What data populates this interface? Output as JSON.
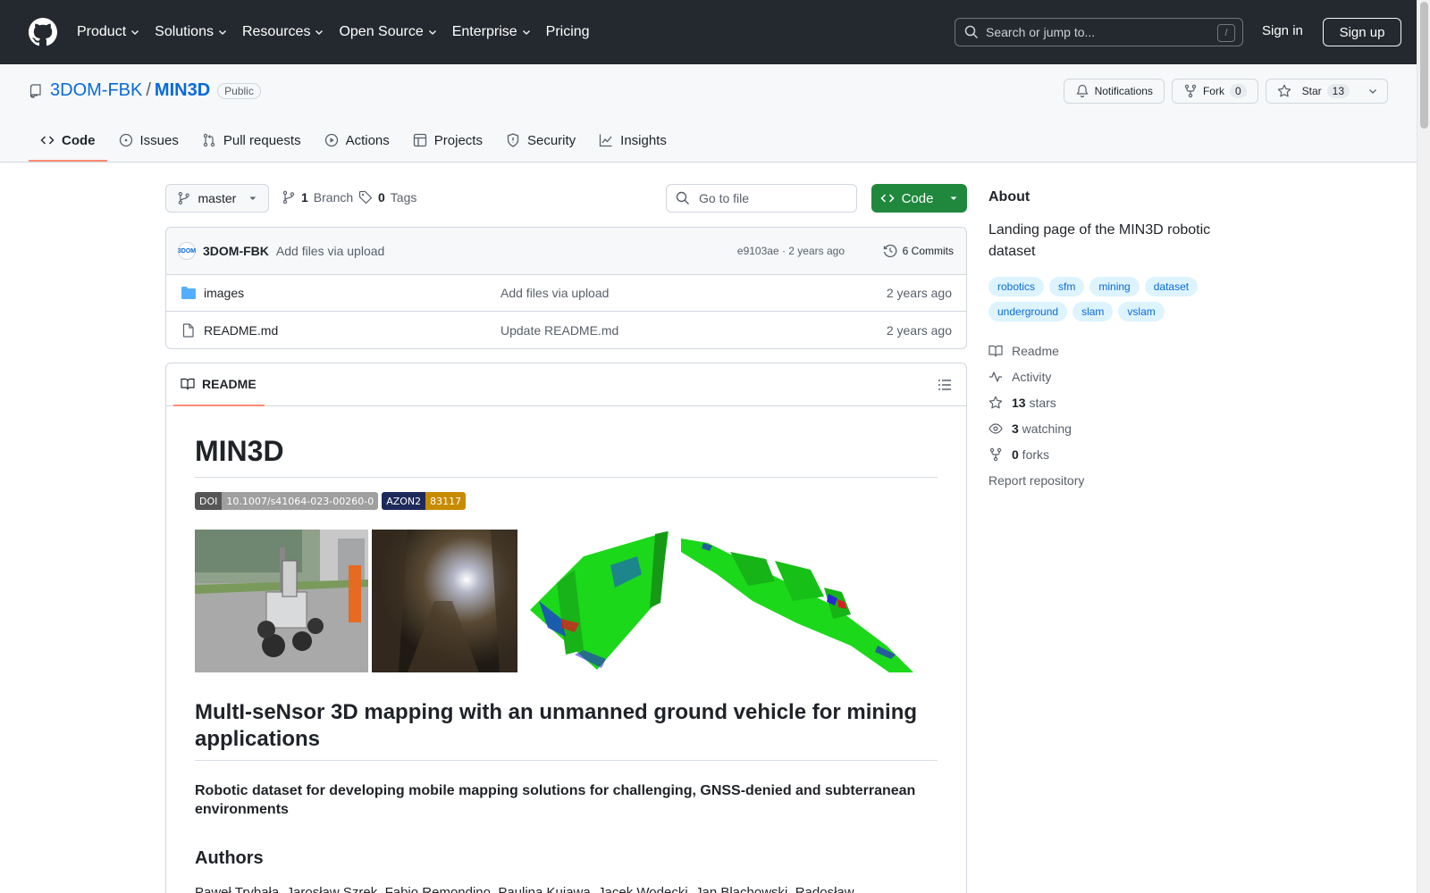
{
  "header": {
    "nav": [
      {
        "label": "Product",
        "has_chevron": true
      },
      {
        "label": "Solutions",
        "has_chevron": true
      },
      {
        "label": "Resources",
        "has_chevron": true
      },
      {
        "label": "Open Source",
        "has_chevron": true
      },
      {
        "label": "Enterprise",
        "has_chevron": true
      },
      {
        "label": "Pricing",
        "has_chevron": false
      }
    ],
    "search_placeholder": "Search or jump to...",
    "search_kbd": "/",
    "sign_in": "Sign in",
    "sign_up": "Sign up"
  },
  "repo": {
    "owner": "3DOM-FBK",
    "separator": "/",
    "name": "MIN3D",
    "visibility": "Public",
    "notifications_label": "Notifications",
    "fork_label": "Fork",
    "fork_count": "0",
    "star_label": "Star",
    "star_count": "13",
    "tabs": [
      "Code",
      "Issues",
      "Pull requests",
      "Actions",
      "Projects",
      "Security",
      "Insights"
    ]
  },
  "toolbar": {
    "branch": "master",
    "branch_count": "1",
    "branch_label": "Branch",
    "tag_count": "0",
    "tag_label": "Tags",
    "goto_placeholder": "Go to file",
    "code_button": "Code"
  },
  "commit": {
    "author": "3DOM-FBK",
    "avatar_text": "3DOM",
    "message": "Add files via upload",
    "meta": "e9103ae · 2 years ago",
    "commits_label": "6 Commits"
  },
  "files": [
    {
      "type": "folder",
      "name": "images",
      "message": "Add files via upload",
      "date": "2 years ago"
    },
    {
      "type": "file",
      "name": "README.md",
      "message": "Update README.md",
      "date": "2 years ago"
    }
  ],
  "readme": {
    "tab_label": "README",
    "h1": "MIN3D",
    "badges": [
      {
        "left": "DOI",
        "right": "10.1007/s41064-023-00260-0",
        "color": "#9f9f9f"
      },
      {
        "left": "AZON2",
        "right": "83117",
        "color": "#c78b00"
      }
    ],
    "h2": "MultI-seNsor 3D mapping with an unmanned ground vehicle for mining applications",
    "h4": "Robotic dataset for developing mobile mapping solutions for challenging, GNSS-denied and subterranean environments",
    "authors_heading": "Authors",
    "authors_line": "Paweł Trybała, Jarosław Szrek, Fabio Remondino, Paulina Kujawa, Jacek Wodecki, Jan Blachowski, Radosław"
  },
  "about": {
    "heading": "About",
    "description": "Landing page of the MIN3D robotic dataset",
    "topics": [
      "robotics",
      "sfm",
      "mining",
      "dataset",
      "underground",
      "slam",
      "vslam"
    ],
    "links": [
      {
        "icon": "book-icon",
        "bold": "",
        "text": "Readme"
      },
      {
        "icon": "pulse-icon",
        "bold": "",
        "text": "Activity"
      },
      {
        "icon": "star-icon",
        "bold": "13",
        "text": " stars"
      },
      {
        "icon": "eye-icon",
        "bold": "3",
        "text": " watching"
      },
      {
        "icon": "fork-icon",
        "bold": "0",
        "text": " forks"
      },
      {
        "icon": "",
        "bold": "",
        "text": "Report repository"
      }
    ]
  },
  "colors": {
    "header_bg": "#24292f",
    "link": "#0969da",
    "primary_button": "#1f883d",
    "active_tab_underline": "#fd8c73",
    "topic_bg": "#ddf4ff"
  }
}
